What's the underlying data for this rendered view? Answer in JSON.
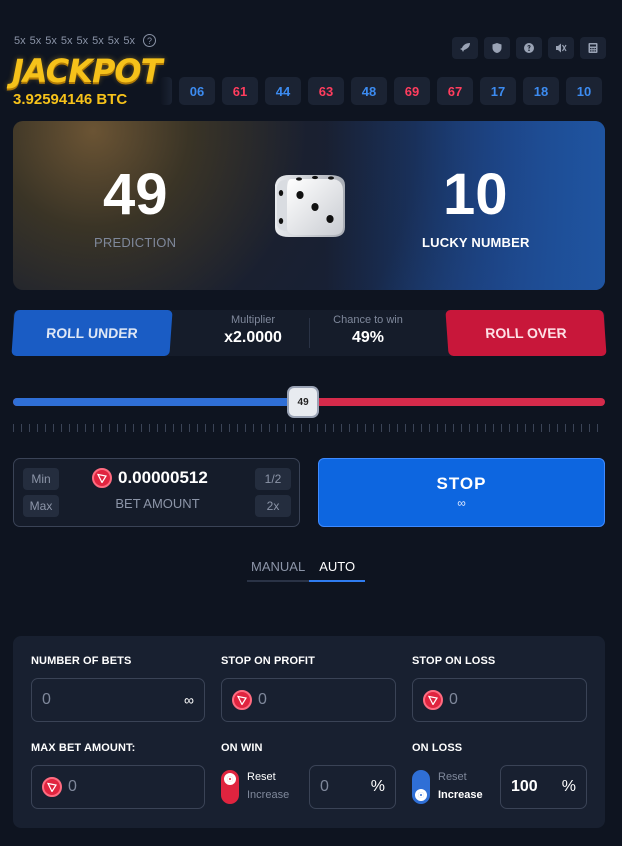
{
  "header": {
    "multipliers": [
      "5x",
      "5x",
      "5x",
      "5x",
      "5x",
      "5x",
      "5x",
      "5x"
    ],
    "jackpot_logo": "JACKPOT",
    "jackpot_amount": "3.92594146 BTC",
    "icons": [
      "rocket-icon",
      "shield-icon",
      "help-icon",
      "mute-icon",
      "calculator-icon"
    ]
  },
  "history": [
    {
      "value": "06",
      "color": "blue"
    },
    {
      "value": "61",
      "color": "red"
    },
    {
      "value": "44",
      "color": "blue"
    },
    {
      "value": "63",
      "color": "red"
    },
    {
      "value": "48",
      "color": "blue"
    },
    {
      "value": "69",
      "color": "red"
    },
    {
      "value": "67",
      "color": "red"
    },
    {
      "value": "17",
      "color": "blue"
    },
    {
      "value": "18",
      "color": "blue"
    },
    {
      "value": "10",
      "color": "blue"
    }
  ],
  "hero": {
    "prediction_value": "49",
    "prediction_label": "PREDICTION",
    "lucky_value": "10",
    "lucky_label": "LUCKY NUMBER"
  },
  "roll": {
    "under_label": "ROLL UNDER",
    "over_label": "ROLL OVER",
    "multiplier_label": "Multiplier",
    "multiplier_value": "x2.0000",
    "chance_label": "Chance to win",
    "chance_value": "49%"
  },
  "slider": {
    "value": 49,
    "min": 0,
    "max": 100,
    "handle_label": "49"
  },
  "bet": {
    "min_label": "Min",
    "max_label": "Max",
    "half_label": "1/2",
    "double_label": "2x",
    "amount": "0.00000512",
    "label": "BET AMOUNT"
  },
  "stop_button": {
    "label": "STOP",
    "sub": "∞"
  },
  "tabs": {
    "manual": "MANUAL",
    "auto": "AUTO",
    "active": "auto"
  },
  "auto": {
    "number_of_bets_label": "NUMBER OF BETS",
    "number_of_bets_value": "0",
    "number_of_bets_suffix": "∞",
    "stop_profit_label": "STOP ON PROFIT",
    "stop_profit_value": "0",
    "stop_loss_label": "STOP ON LOSS",
    "stop_loss_value": "0",
    "max_bet_label": "MAX BET AMOUNT:",
    "max_bet_value": "0",
    "on_win_label": "ON WIN",
    "on_win_reset": "Reset",
    "on_win_increase": "Increase",
    "on_win_value": "0",
    "on_win_unit": "%",
    "on_loss_label": "ON LOSS",
    "on_loss_reset": "Reset",
    "on_loss_increase": "Increase",
    "on_loss_value": "100",
    "on_loss_unit": "%"
  },
  "colors": {
    "blue": "#3c8bf0",
    "red": "#ff3d5e",
    "accent": "#0d66e0",
    "jackpot": "#f6c21a"
  }
}
